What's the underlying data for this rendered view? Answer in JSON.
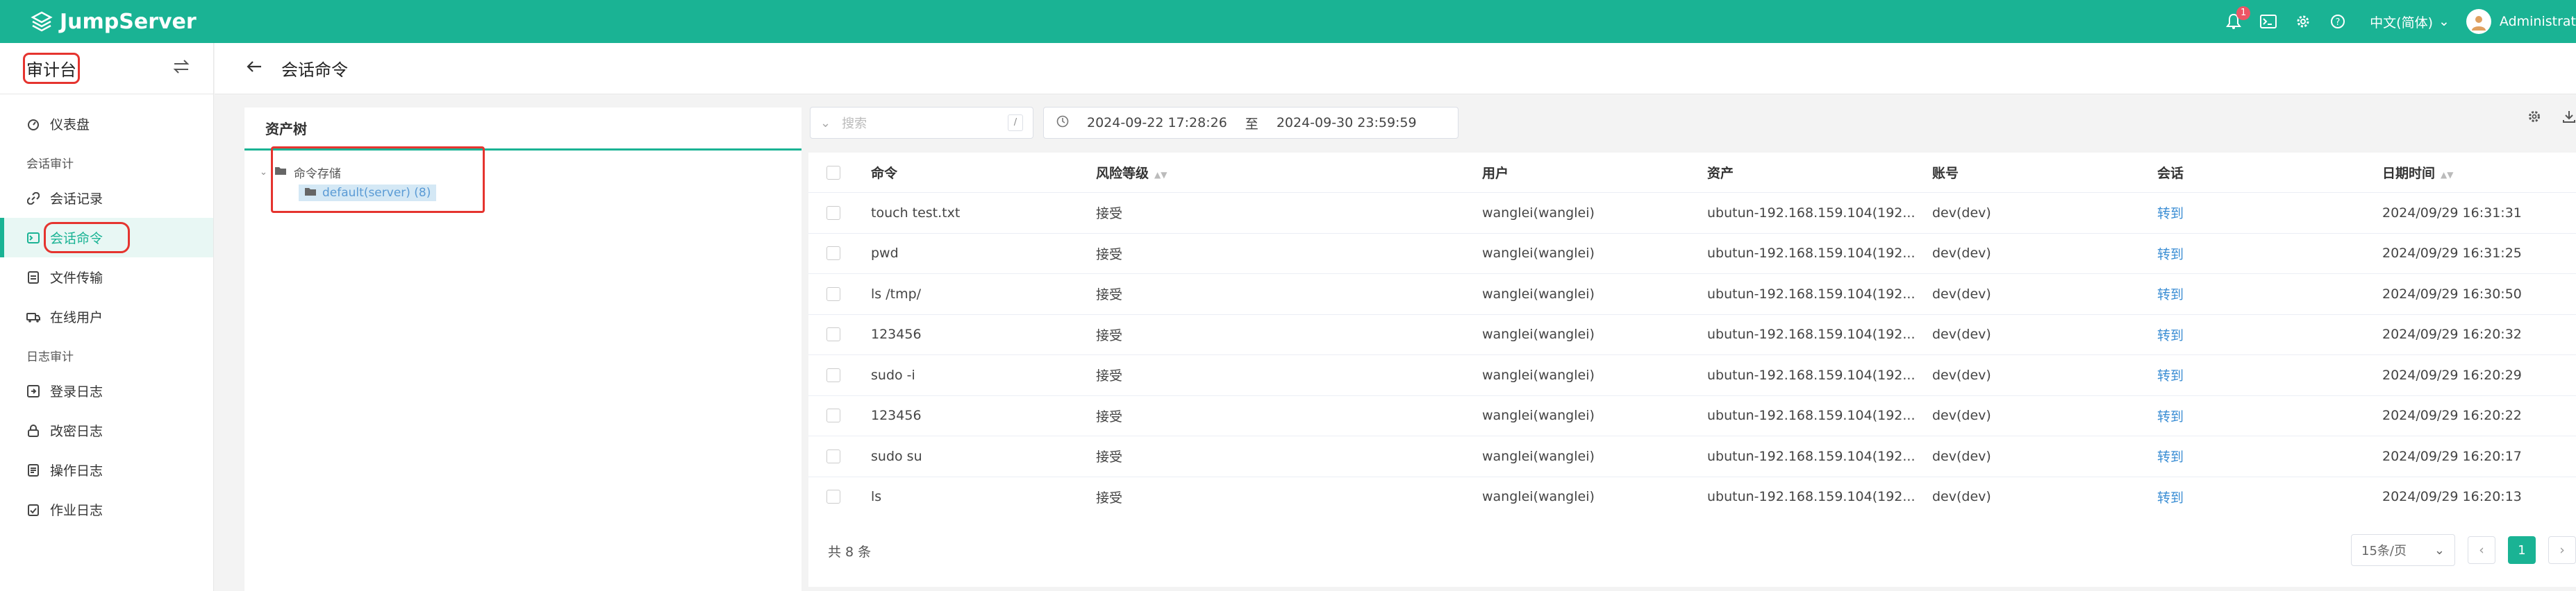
{
  "app": {
    "brand": "JumpServer",
    "notification_count": "1",
    "language": "中文(简体)",
    "user": "Administrat"
  },
  "sidebar": {
    "title": "审计台",
    "items": [
      {
        "label": "仪表盘",
        "icon": "dashboard-icon"
      },
      {
        "group": "会话审计"
      },
      {
        "label": "会话记录",
        "icon": "link-icon"
      },
      {
        "label": "会话命令",
        "icon": "terminal-icon",
        "active": true
      },
      {
        "label": "文件传输",
        "icon": "file-transfer-icon"
      },
      {
        "label": "在线用户",
        "icon": "online-user-icon"
      },
      {
        "group": "日志审计"
      },
      {
        "label": "登录日志",
        "icon": "login-log-icon"
      },
      {
        "label": "改密日志",
        "icon": "lock-icon"
      },
      {
        "label": "操作日志",
        "icon": "operation-log-icon"
      },
      {
        "label": "作业日志",
        "icon": "job-log-icon"
      }
    ]
  },
  "header": {
    "title": "会话命令"
  },
  "tree": {
    "title": "资产树",
    "root": "命令存储",
    "child": "default(server) (8)"
  },
  "toolbar": {
    "search_placeholder": "搜索",
    "search_shortcut": "/",
    "date_from": "2024-09-22 17:28:26",
    "date_sep": "至",
    "date_to": "2024-09-30 23:59:59"
  },
  "table": {
    "columns": [
      "命令",
      "风险等级",
      "用户",
      "资产",
      "账号",
      "会话",
      "日期时间"
    ],
    "rows": [
      [
        "touch test.txt",
        "接受",
        "wanglei(wanglei)",
        "ubutun-192.168.159.104(192....",
        "dev(dev)",
        "转到",
        "2024/09/29 16:31:31"
      ],
      [
        "pwd",
        "接受",
        "wanglei(wanglei)",
        "ubutun-192.168.159.104(192....",
        "dev(dev)",
        "转到",
        "2024/09/29 16:31:25"
      ],
      [
        "ls /tmp/",
        "接受",
        "wanglei(wanglei)",
        "ubutun-192.168.159.104(192....",
        "dev(dev)",
        "转到",
        "2024/09/29 16:30:50"
      ],
      [
        "123456",
        "接受",
        "wanglei(wanglei)",
        "ubutun-192.168.159.104(192....",
        "dev(dev)",
        "转到",
        "2024/09/29 16:20:32"
      ],
      [
        "sudo -i",
        "接受",
        "wanglei(wanglei)",
        "ubutun-192.168.159.104(192....",
        "dev(dev)",
        "转到",
        "2024/09/29 16:20:29"
      ],
      [
        "123456",
        "接受",
        "wanglei(wanglei)",
        "ubutun-192.168.159.104(192....",
        "dev(dev)",
        "转到",
        "2024/09/29 16:20:22"
      ],
      [
        "sudo su",
        "接受",
        "wanglei(wanglei)",
        "ubutun-192.168.159.104(192....",
        "dev(dev)",
        "转到",
        "2024/09/29 16:20:17"
      ],
      [
        "ls",
        "接受",
        "wanglei(wanglei)",
        "ubutun-192.168.159.104(192....",
        "dev(dev)",
        "转到",
        "2024/09/29 16:20:13"
      ]
    ]
  },
  "footer": {
    "total": "共 8 条",
    "page_size": "15条/页",
    "current_page": "1"
  },
  "colors": {
    "brand": "#1ab394",
    "link": "#3b8ed4",
    "highlight": "#e5342f"
  }
}
